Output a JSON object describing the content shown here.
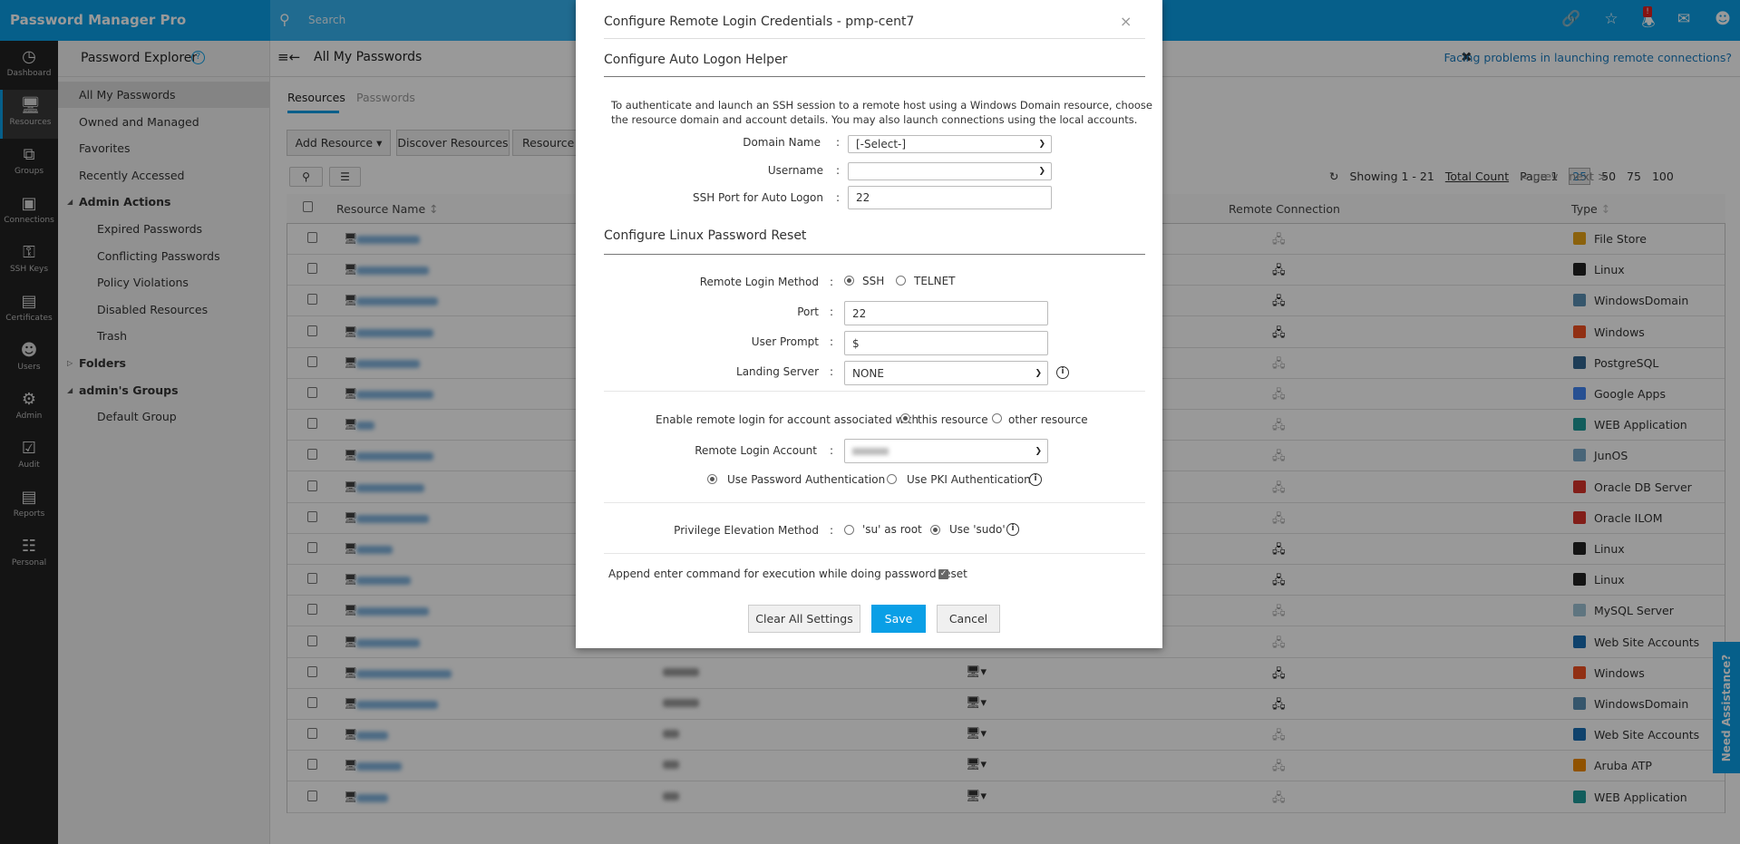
{
  "app": {
    "title": "Password Manager Pro",
    "search_placeholder": "Search"
  },
  "topbar_icons": [
    "link-icon",
    "user-star-icon",
    "bell-icon",
    "mail-icon",
    "user-icon"
  ],
  "notification_badge": "!",
  "nav": [
    {
      "label": "Dashboard",
      "icon": "dashboard-icon"
    },
    {
      "label": "Resources",
      "icon": "monitor-icon",
      "active": true
    },
    {
      "label": "Groups",
      "icon": "groups-icon"
    },
    {
      "label": "Connections",
      "icon": "connections-icon"
    },
    {
      "label": "SSH Keys",
      "icon": "ssh-key-icon"
    },
    {
      "label": "Certificates",
      "icon": "certificate-icon"
    },
    {
      "label": "Users",
      "icon": "user-icon"
    },
    {
      "label": "Admin",
      "icon": "gear-icon"
    },
    {
      "label": "Audit",
      "icon": "clipboard-icon"
    },
    {
      "label": "Reports",
      "icon": "bar-chart-icon"
    },
    {
      "label": "Personal",
      "icon": "contact-icon"
    }
  ],
  "explorer": {
    "title": "Password Explorer",
    "items": [
      {
        "label": "All My Passwords",
        "active": true
      },
      {
        "label": "Owned and Managed"
      },
      {
        "label": "Favorites"
      },
      {
        "label": "Recently Accessed"
      },
      {
        "label": "Admin Actions",
        "group": true,
        "expanded": true
      },
      {
        "label": "Expired Passwords",
        "sub": true
      },
      {
        "label": "Conflicting Passwords",
        "sub": true
      },
      {
        "label": "Policy Violations",
        "sub": true
      },
      {
        "label": "Disabled Resources",
        "sub": true
      },
      {
        "label": "Trash",
        "sub": true
      },
      {
        "label": "Folders",
        "group": true,
        "expanded": false
      },
      {
        "label": "admin's Groups",
        "group": true,
        "expanded": true
      },
      {
        "label": "Default Group",
        "sub": true
      }
    ]
  },
  "main": {
    "title": "All My Passwords",
    "help_link": "Facing problems in launching remote connections?",
    "tabs": [
      {
        "label": "Resources",
        "active": true
      },
      {
        "label": "Passwords"
      }
    ],
    "toolbar": {
      "add_resource": "Add Resource",
      "discover": "Discover Resources",
      "resource_t": "Resource T"
    },
    "pager": {
      "showing": "Showing 1 - 21",
      "total_count": "Total Count",
      "prev": "< prev",
      "page": "Page 1",
      "next": "next >",
      "sizes": [
        "25",
        "50",
        "75",
        "100"
      ],
      "selected_size": "25"
    },
    "columns": {
      "name": "Resource Name",
      "remote": "Remote Connection",
      "type": "Type"
    },
    "rows": [
      {
        "type": "File Store",
        "rc": "off",
        "color": "#e8a317"
      },
      {
        "type": "Linux",
        "rc": "on",
        "color": "#222"
      },
      {
        "type": "WindowsDomain",
        "rc": "on",
        "color": "#5a8fb5"
      },
      {
        "type": "Windows",
        "rc": "on",
        "color": "#f25022"
      },
      {
        "type": "PostgreSQL",
        "rc": "off",
        "color": "#336791"
      },
      {
        "type": "Google Apps",
        "rc": "off",
        "color": "#4285f4"
      },
      {
        "type": "WEB Application",
        "rc": "off",
        "color": "#1e9c9a"
      },
      {
        "type": "JunOS",
        "rc": "off",
        "color": "#7aa8c8"
      },
      {
        "type": "Oracle DB Server",
        "rc": "off",
        "color": "#d9322b"
      },
      {
        "type": "Oracle ILOM",
        "rc": "off",
        "color": "#d9322b"
      },
      {
        "type": "Linux",
        "rc": "on",
        "color": "#222"
      },
      {
        "type": "Linux",
        "rc": "on",
        "color": "#222"
      },
      {
        "type": "MySQL Server",
        "rc": "off",
        "color": "#9ec3d6"
      },
      {
        "type": "Web Site Accounts",
        "rc": "off",
        "color": "#1a6fb5"
      },
      {
        "type": "Windows",
        "rc": "on",
        "color": "#f25022",
        "conn": true
      },
      {
        "type": "WindowsDomain",
        "rc": "on",
        "color": "#5a8fb5",
        "conn": true
      },
      {
        "type": "Web Site Accounts",
        "rc": "off",
        "color": "#1a6fb5",
        "conn": true
      },
      {
        "type": "Aruba ATP",
        "rc": "off",
        "color": "#f08a00",
        "conn": true
      },
      {
        "type": "WEB Application",
        "rc": "off",
        "color": "#1e9c9a",
        "conn": true
      }
    ]
  },
  "assist": "Need Assistance?",
  "modal": {
    "title": "Configure Remote Login Credentials - pmp-cent7",
    "close": "×",
    "auto_logon": {
      "heading": "Configure Auto Logon Helper",
      "desc1": "To authenticate and launch an SSH session to a remote host using a Windows Domain resource, choose",
      "desc2": "the resource domain and account details. You may also launch connections using the local accounts.",
      "domain_label": "Domain Name",
      "domain_value": "[-Select-]",
      "username_label": "Username",
      "username_value": "",
      "ssh_port_label": "SSH Port for Auto Logon",
      "ssh_port_value": "22"
    },
    "linux_reset": {
      "heading": "Configure Linux Password Reset",
      "method_label": "Remote Login Method",
      "method_options": [
        "SSH",
        "TELNET"
      ],
      "method_selected": "SSH",
      "port_label": "Port",
      "port_value": "22",
      "prompt_label": "User Prompt",
      "prompt_value": "$",
      "landing_label": "Landing Server",
      "landing_value": "NONE",
      "enable_label": "Enable remote login for account associated with",
      "enable_options": [
        "this resource",
        "other resource"
      ],
      "enable_selected": "this resource",
      "account_label": "Remote Login Account",
      "auth_options": [
        "Use Password Authentication",
        "Use PKI Authentication"
      ],
      "auth_selected": "Use Password Authentication",
      "priv_label": "Privilege Elevation Method",
      "priv_options": [
        "'su' as root",
        "Use 'sudo'"
      ],
      "priv_selected": "Use 'sudo'",
      "append_label": "Append enter command for execution while doing password reset",
      "append_checked": true
    },
    "buttons": {
      "clear": "Clear All Settings",
      "save": "Save",
      "cancel": "Cancel"
    }
  }
}
